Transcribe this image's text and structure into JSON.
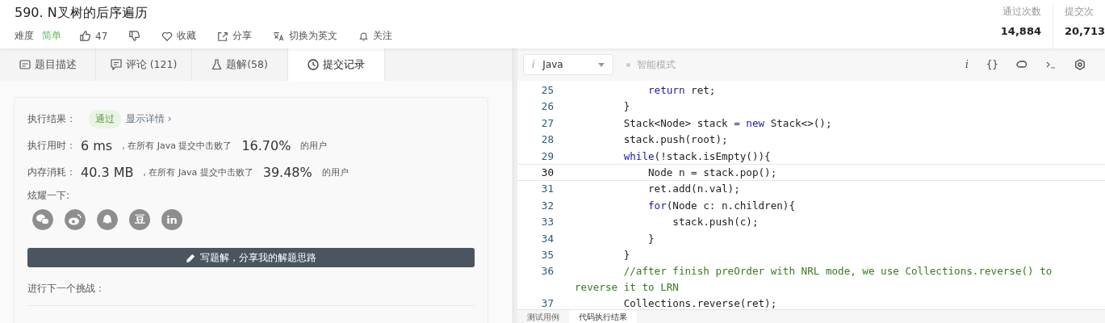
{
  "problem": {
    "title": "590. N叉树的后序遍历",
    "difficulty_label": "难度",
    "difficulty": "简单",
    "likes": "47",
    "actions": [
      {
        "kind": "star",
        "label": "收藏"
      },
      {
        "kind": "share",
        "label": "分享"
      },
      {
        "kind": "translate",
        "label": "切换为英文"
      },
      {
        "kind": "bell",
        "label": "关注"
      }
    ]
  },
  "stats": [
    {
      "label": "通过次数",
      "value": "14,884"
    },
    {
      "label": "提交次",
      "value": "20,713"
    }
  ],
  "tabs": [
    {
      "kind": "desc",
      "label": "题目描述",
      "selected": false
    },
    {
      "kind": "comment",
      "label": "评论 (121)",
      "selected": false
    },
    {
      "kind": "flask",
      "label": "题解(58)",
      "selected": false
    },
    {
      "kind": "clock",
      "label": "提交记录",
      "selected": true
    }
  ],
  "result": {
    "label": "执行结果：",
    "status": "通过",
    "details": "显示详情 ›",
    "metrics": [
      {
        "label": "执行用时：",
        "value": "6 ms",
        "mid": ", 在所有 Java 提交中击败了",
        "percent": "16.70%",
        "tail": "的用户"
      },
      {
        "label": "内存消耗：",
        "value": "40.3 MB",
        "mid": ", 在所有 Java 提交中击败了",
        "percent": "39.48%",
        "tail": "的用户"
      }
    ],
    "share_label": "炫耀一下:",
    "share": [
      {
        "kind": "wechat"
      },
      {
        "kind": "weibo"
      },
      {
        "kind": "qq"
      },
      {
        "kind": "text",
        "text": "豆"
      },
      {
        "kind": "text",
        "text": "in"
      }
    ],
    "write_button": "写题解，分享我的解题思路",
    "next_label": "进行下一个挑战："
  },
  "editor": {
    "language": "Java",
    "language_icon": "i",
    "smart_mode": "智能模式",
    "tools": [
      {
        "kind": "text",
        "text": "i"
      },
      {
        "kind": "text",
        "text": "{}"
      },
      {
        "kind": "undo"
      },
      {
        "kind": "terminal"
      },
      {
        "kind": "gear"
      }
    ],
    "lines": [
      {
        "no": "25",
        "current": false,
        "comment": false,
        "segs": [
          {
            "t": "            return",
            "kw": true
          },
          {
            "t": " ret;",
            "kw": false
          }
        ]
      },
      {
        "no": "26",
        "current": false,
        "comment": false,
        "segs": [
          {
            "t": "        }",
            "kw": false
          }
        ]
      },
      {
        "no": "27",
        "current": false,
        "comment": false,
        "segs": [
          {
            "t": "        Stack<Node> stack = ",
            "kw": false
          },
          {
            "t": "new",
            "kw": true
          },
          {
            "t": " Stack<>();",
            "kw": false
          }
        ]
      },
      {
        "no": "28",
        "current": false,
        "comment": false,
        "segs": [
          {
            "t": "        stack.push(root);",
            "kw": false
          }
        ]
      },
      {
        "no": "29",
        "current": false,
        "comment": false,
        "segs": [
          {
            "t": "        while",
            "kw": true
          },
          {
            "t": "(!stack.isEmpty()){",
            "kw": false
          }
        ]
      },
      {
        "no": "30",
        "current": true,
        "comment": false,
        "segs": [
          {
            "t": "            Node n = stack.pop();",
            "kw": false
          }
        ]
      },
      {
        "no": "31",
        "current": false,
        "comment": false,
        "segs": [
          {
            "t": "            ret.add(n.val);",
            "kw": false
          }
        ]
      },
      {
        "no": "32",
        "current": false,
        "comment": false,
        "segs": [
          {
            "t": "            for",
            "kw": true
          },
          {
            "t": "(Node c: n.children){",
            "kw": false
          }
        ]
      },
      {
        "no": "33",
        "current": false,
        "comment": false,
        "segs": [
          {
            "t": "                stack.push(c);",
            "kw": false
          }
        ]
      },
      {
        "no": "34",
        "current": false,
        "comment": false,
        "segs": [
          {
            "t": "            }",
            "kw": false
          }
        ]
      },
      {
        "no": "35",
        "current": false,
        "comment": false,
        "segs": [
          {
            "t": "        }",
            "kw": false
          }
        ]
      },
      {
        "no": "36",
        "current": false,
        "comment": true,
        "segs": [
          {
            "t": "        //after finish preOrder with NRL mode, we use Collections.reverse() to reverse it to LRN",
            "kw": false
          }
        ]
      },
      {
        "no": "37",
        "current": false,
        "comment": false,
        "segs": [
          {
            "t": "        Collections.reverse(ret);",
            "kw": false
          }
        ]
      }
    ],
    "bottom_tabs": [
      {
        "label": "测试用例",
        "selected": false
      },
      {
        "label": "代码执行结果",
        "selected": true
      }
    ]
  }
}
